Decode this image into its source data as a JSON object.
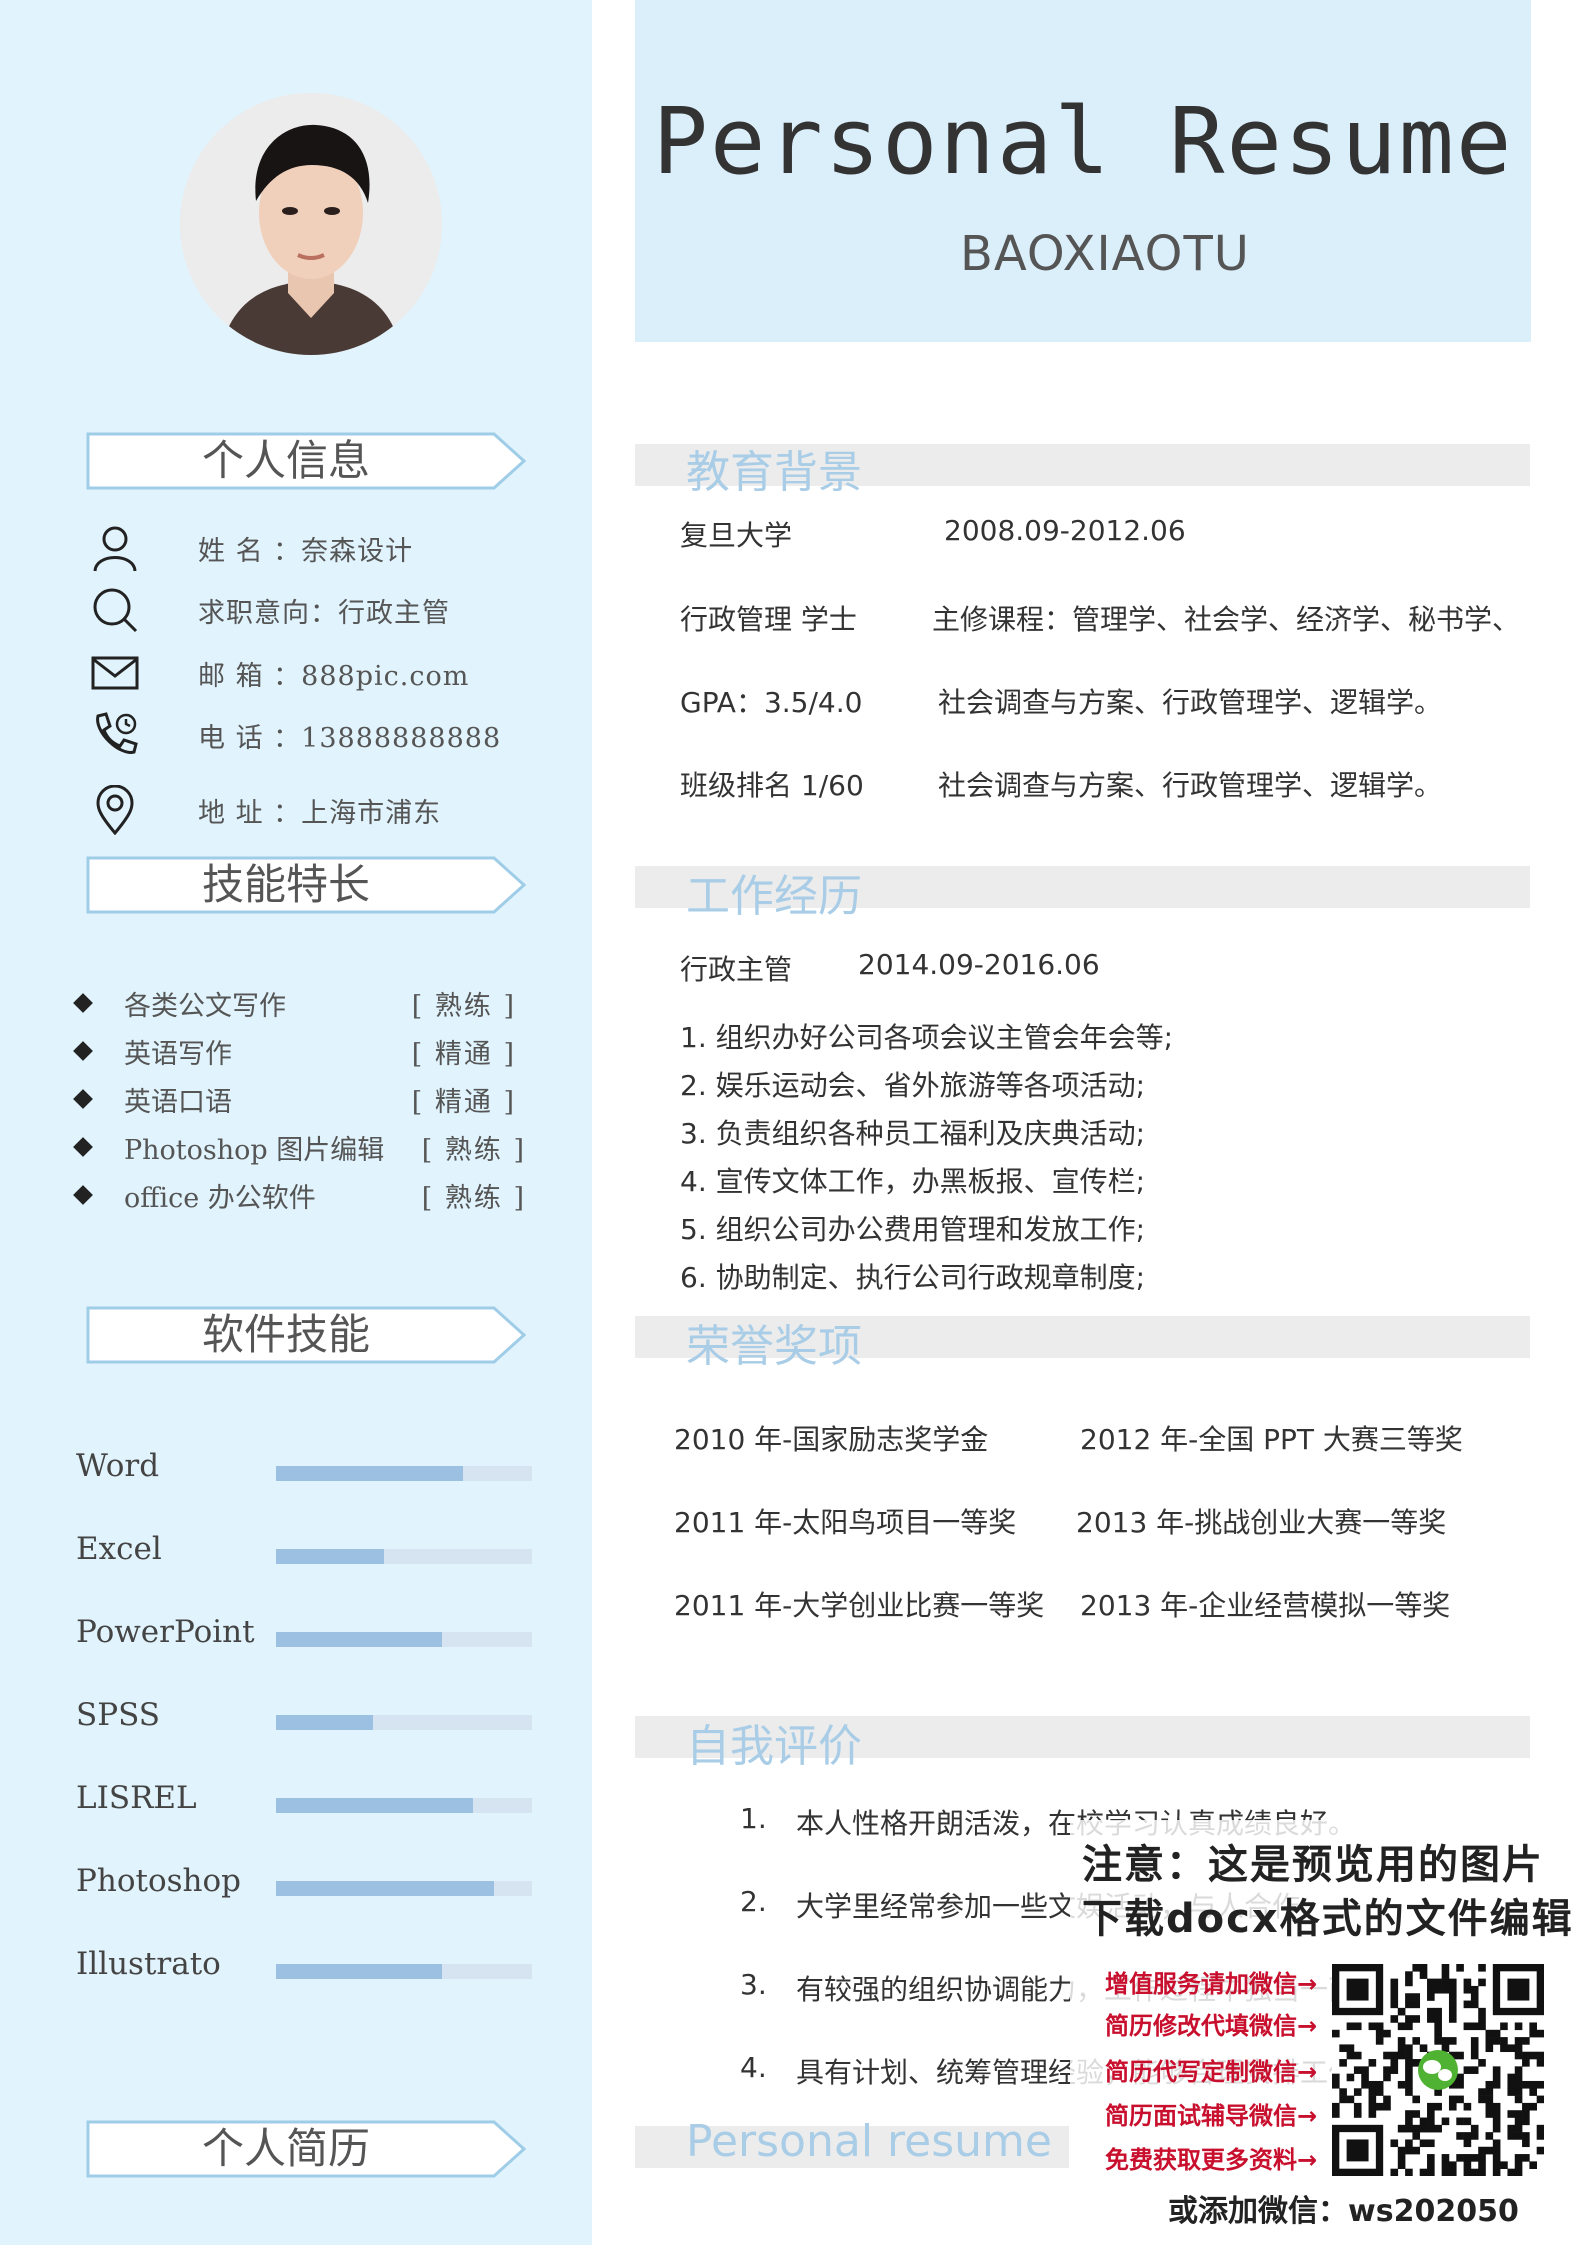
{
  "header": {
    "title": "Personal Resume",
    "name": "BAOXIAOTU"
  },
  "sidebar": {
    "headings": {
      "info": "个人信息",
      "skills": "技能特长",
      "software": "软件技能",
      "profile": "个人简历"
    },
    "info": [
      {
        "icon": "user-icon",
        "text": "姓  名 ：奈森设计"
      },
      {
        "icon": "search-icon",
        "text": "求职意向：行政主管"
      },
      {
        "icon": "mail-icon",
        "text": "邮  箱 ：888pic.com"
      },
      {
        "icon": "phone-icon",
        "text": "电  话 ：13888888888"
      },
      {
        "icon": "location-icon",
        "text": "地  址 ：上海市浦东"
      }
    ],
    "skills": [
      {
        "name": "各类公文写作",
        "level": "[ 熟练 ]"
      },
      {
        "name": "英语写作",
        "level": "[ 精通 ]"
      },
      {
        "name": "英语口语",
        "level": "[ 精通 ]"
      },
      {
        "name": "Photoshop 图片编辑",
        "level": "[ 熟练 ]"
      },
      {
        "name": "office 办公软件",
        "level": "[ 熟练 ]"
      }
    ],
    "software": [
      {
        "name": "Word",
        "level": 0.73
      },
      {
        "name": "Excel",
        "level": 0.42
      },
      {
        "name": "PowerPoint",
        "level": 0.65
      },
      {
        "name": "SPSS",
        "level": 0.38
      },
      {
        "name": "LISREL",
        "level": 0.77
      },
      {
        "name": "Photoshop",
        "level": 0.85
      },
      {
        "name": "Illustrato",
        "level": 0.65
      }
    ]
  },
  "education": {
    "title": "教育背景",
    "school": "复旦大学",
    "period": "2008.09-2012.06",
    "degree": "行政管理  学士",
    "courses_1": "主修课程：管理学、社会学、经济学、秘书学、",
    "gpa": "GPA：3.5/4.0",
    "courses_2": "社会调查与方案、行政管理学、逻辑学。",
    "rank": "班级排名  1/60",
    "courses_3": "社会调查与方案、行政管理学、逻辑学。"
  },
  "work": {
    "title": "工作经历",
    "position": "行政主管",
    "period": "2014.09-2016.06",
    "duties": [
      "1. 组织办好公司各项会议主管会年会等;",
      "2. 娱乐运动会、省外旅游等各项活动;",
      "3. 负责组织各种员工福利及庆典活动;",
      "4. 宣传文体工作，办黑板报、宣传栏;",
      "5. 组织公司办公费用管理和发放工作;",
      "6. 协助制定、执行公司行政规章制度;"
    ]
  },
  "honors": {
    "title": "荣誉奖项",
    "items": [
      "2010 年-国家励志奖学金",
      "2012 年-全国 PPT 大赛三等奖",
      "2011 年-太阳鸟项目一等奖",
      "2013 年-挑战创业大赛一等奖",
      "2011 年-大学创业比赛一等奖",
      "2013 年-企业经营模拟一等奖"
    ]
  },
  "self": {
    "title": "自我评价",
    "items": [
      {
        "num": "1.",
        "text": "本人性格开朗活泼，在校学习认真成绩良好。"
      },
      {
        "num": "2.",
        "text": "大学里经常参加一些文娱活动，与人合作"
      },
      {
        "num": "3.",
        "text": "有较强的组织协调能力，工作过程中独当一面"
      },
      {
        "num": "4.",
        "text": "具有计划、统筹管理经验，能够合理安排工作"
      }
    ]
  },
  "footer": {
    "title": "Personal resume"
  },
  "watermark": {
    "line1": "注意：这是预览用的图片",
    "line2": "下载docx格式的文件编辑",
    "links": [
      "增值服务请加微信→",
      "简历修改代填微信→",
      "简历代写定制微信→",
      "简历面试辅导微信→",
      "免费获取更多资料→"
    ],
    "wechat": "或添加微信：ws202050"
  }
}
